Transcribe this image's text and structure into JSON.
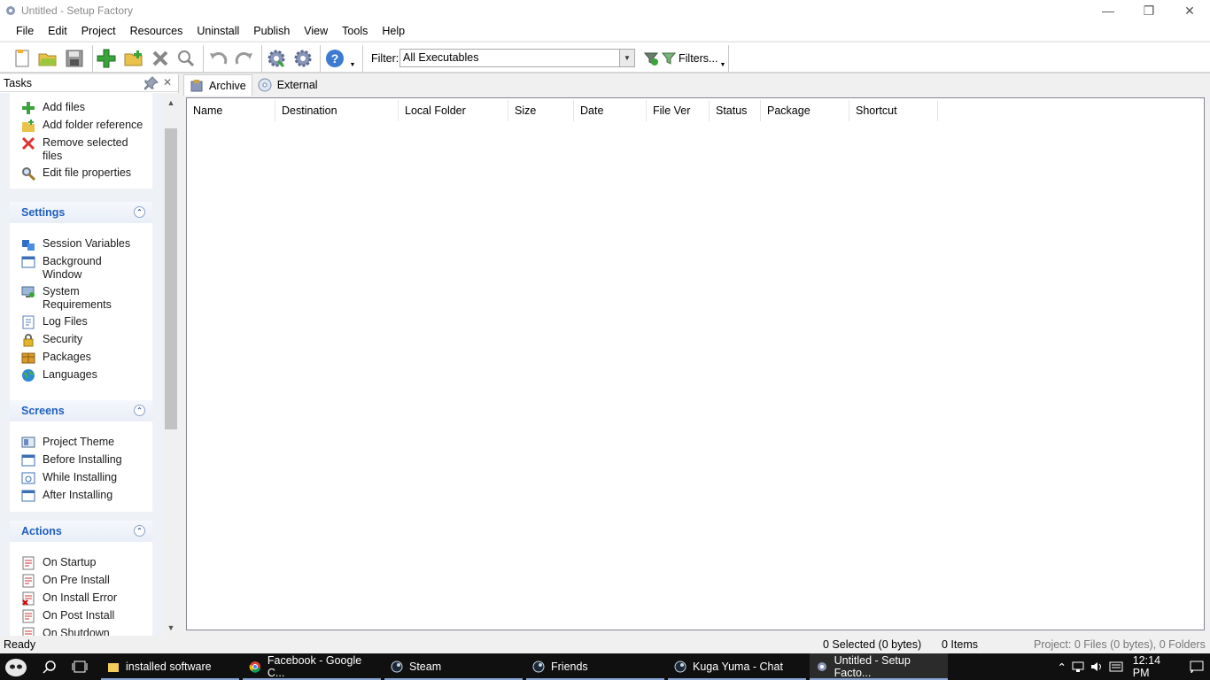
{
  "window": {
    "title": "Untitled - Setup Factory",
    "colors": {
      "accent": "#1f5fbf",
      "taskbar": "#101010"
    }
  },
  "menu": [
    "File",
    "Edit",
    "Project",
    "Resources",
    "Uninstall",
    "Publish",
    "View",
    "Tools",
    "Help"
  ],
  "toolbar": {
    "icons": [
      "new-project-icon",
      "open-project-icon",
      "save-icon",
      "add-files-icon",
      "add-folder-icon",
      "remove-icon",
      "find-icon",
      "undo-icon",
      "redo-icon",
      "build-icon",
      "publish-icon",
      "help-icon"
    ],
    "filter_label": "Filter:",
    "filter_value": "All Executables",
    "filters_button": "Filters..."
  },
  "tasks_panel": {
    "header": "Tasks",
    "files": [
      "Add files",
      "Add folder reference",
      "Remove selected files",
      "Edit file properties"
    ],
    "settings": {
      "title": "Settings",
      "items": [
        "Session Variables",
        "Background Window",
        "System Requirements",
        "Log Files",
        "Security",
        "Packages",
        "Languages"
      ]
    },
    "screens": {
      "title": "Screens",
      "items": [
        "Project Theme",
        "Before Installing",
        "While Installing",
        "After Installing"
      ]
    },
    "actions": {
      "title": "Actions",
      "items": [
        "On Startup",
        "On Pre Install",
        "On Install Error",
        "On Post Install",
        "On Shutdown"
      ]
    }
  },
  "tabs": [
    "Archive",
    "External"
  ],
  "columns": [
    "Name",
    "Destination",
    "Local Folder",
    "Size",
    "Date",
    "File Ver",
    "Status",
    "Package",
    "Shortcut"
  ],
  "status": {
    "ready": "Ready",
    "selected": "0 Selected (0 bytes)",
    "items": "0 Items",
    "project": "Project: 0 Files (0 bytes), 0 Folders"
  },
  "taskbar": {
    "apps": [
      "installed software",
      "Facebook - Google C...",
      "Steam",
      "Friends",
      "Kuga Yuma - Chat",
      "Untitled - Setup Facto..."
    ],
    "clock": "12:14 PM"
  }
}
